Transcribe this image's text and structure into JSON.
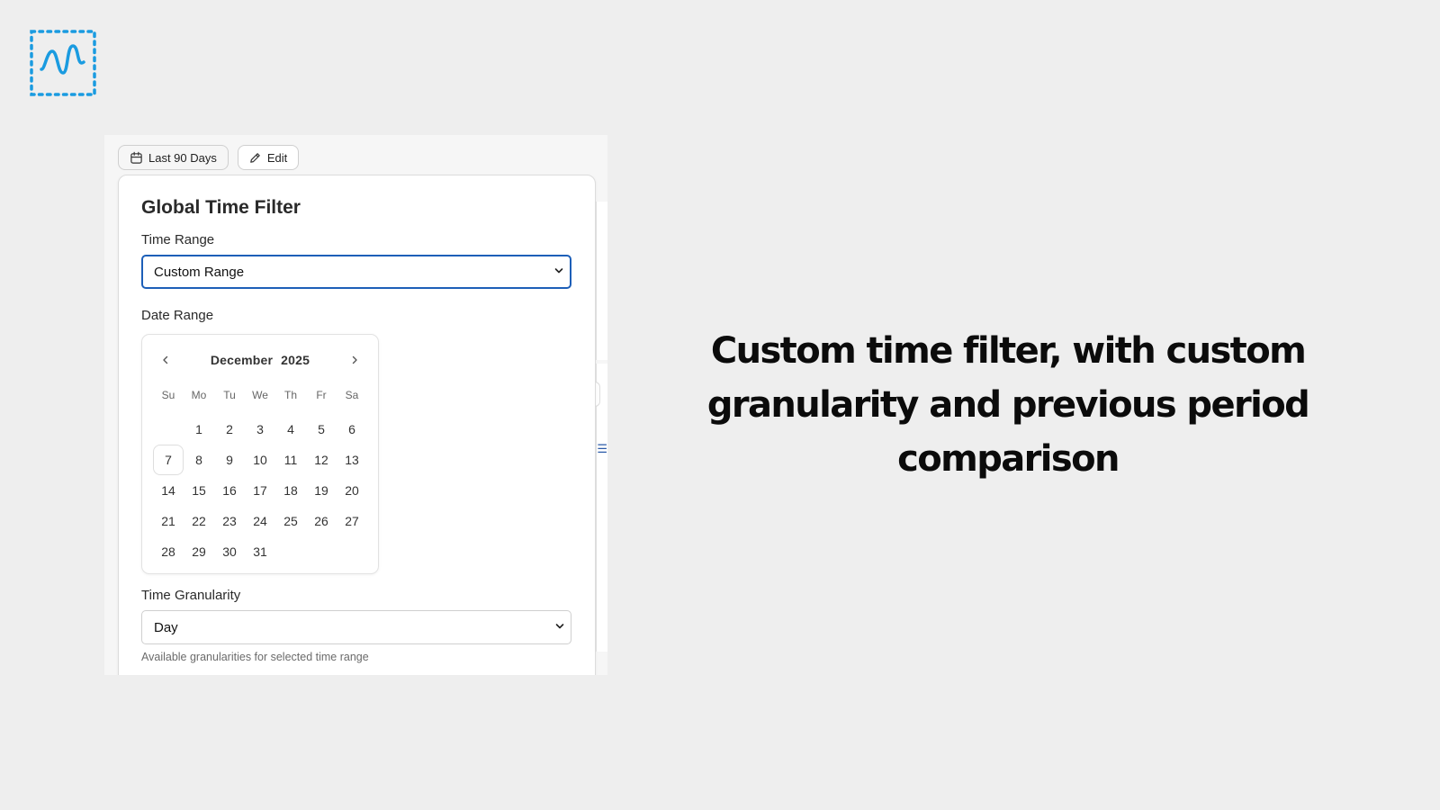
{
  "logo": {
    "name": "brand-logo",
    "color": "#1a9be0"
  },
  "toolbar": {
    "range_button": {
      "icon": "calendar-icon",
      "label": "Last 90 Days"
    },
    "edit_button": {
      "icon": "pencil-icon",
      "label": "Edit"
    }
  },
  "filter_panel": {
    "title": "Global Time Filter",
    "time_range": {
      "label": "Time Range",
      "value": "Custom Range"
    },
    "date_range": {
      "label": "Date Range",
      "calendar": {
        "month": "December",
        "year": "2025",
        "weekdays": [
          "Su",
          "Mo",
          "Tu",
          "We",
          "Th",
          "Fr",
          "Sa"
        ],
        "days": [
          "1",
          "2",
          "3",
          "4",
          "5",
          "6",
          "7",
          "8",
          "9",
          "10",
          "11",
          "12",
          "13",
          "14",
          "15",
          "16",
          "17",
          "18",
          "19",
          "20",
          "21",
          "22",
          "23",
          "24",
          "25",
          "26",
          "27",
          "28",
          "29",
          "30",
          "31"
        ],
        "today": "7"
      }
    },
    "granularity": {
      "label": "Time Granularity",
      "value": "Day",
      "hint": "Available granularities for selected time range"
    }
  },
  "headline": {
    "line1": "Custom time filter, with custom",
    "line2": "granularity and previous period",
    "line3": "comparison"
  },
  "colors": {
    "accent": "#1d5fb8",
    "logo": "#1a9be0",
    "background": "#eeeeee"
  }
}
